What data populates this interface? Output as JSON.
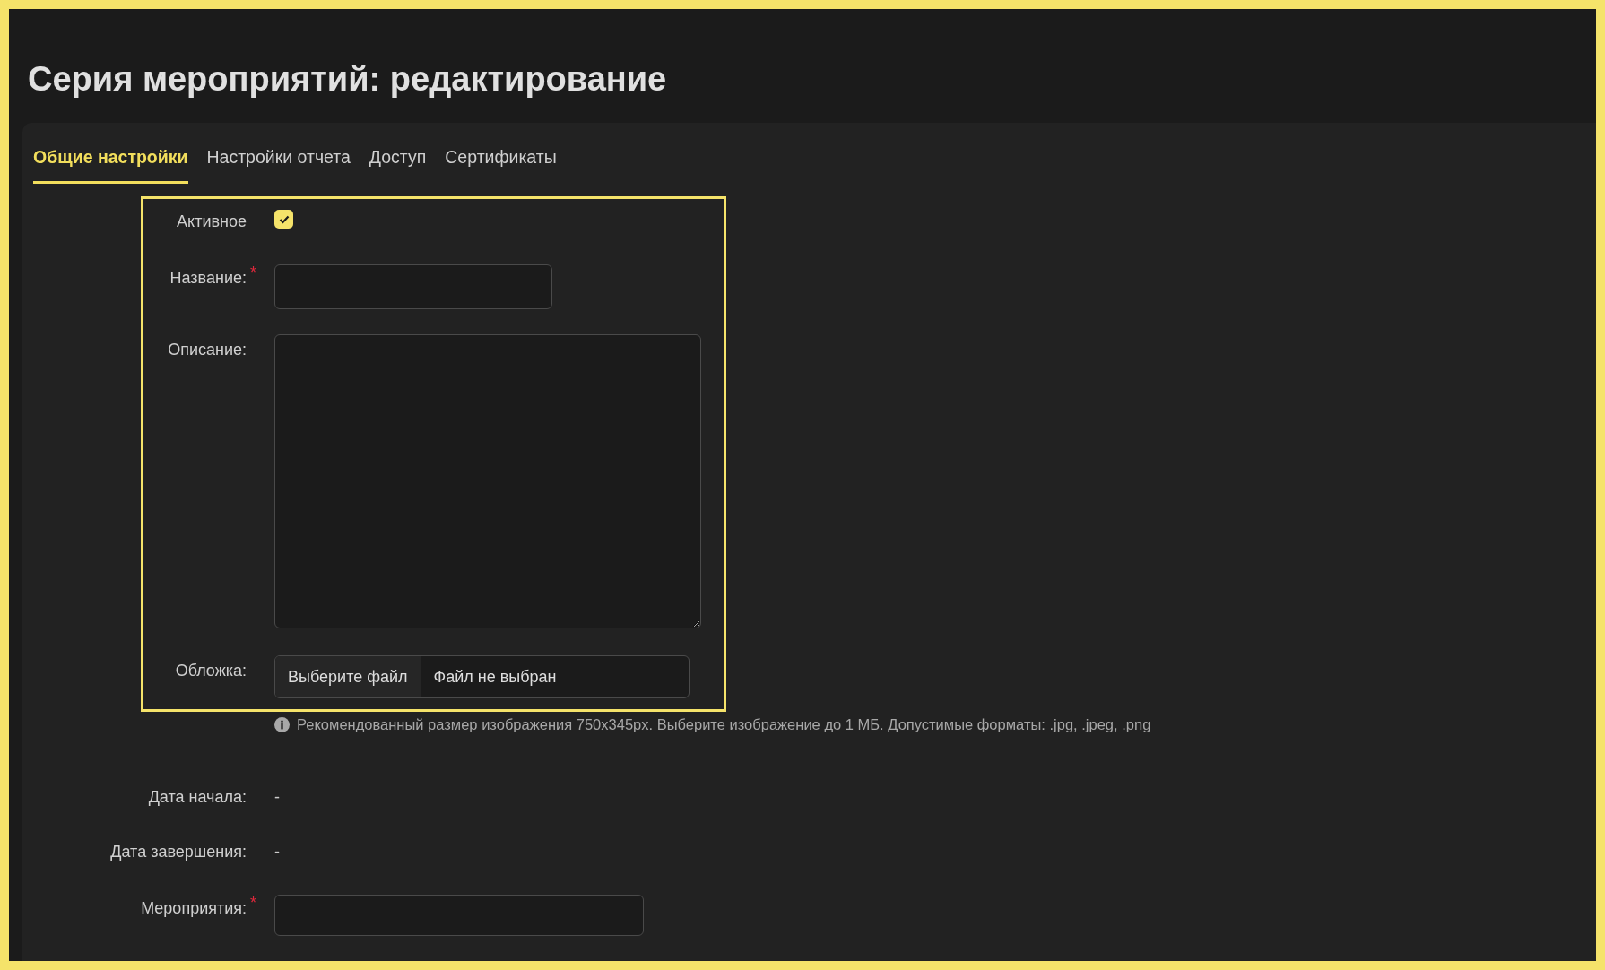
{
  "title": "Серия мероприятий: редактирование",
  "tabs": [
    {
      "label": "Общие настройки",
      "selected": true
    },
    {
      "label": "Настройки отчета",
      "selected": false
    },
    {
      "label": "Доступ",
      "selected": false
    },
    {
      "label": "Сертификаты",
      "selected": false
    }
  ],
  "form": {
    "rows": [
      {
        "kind": "checkbox",
        "label": "Активное",
        "checked": true,
        "highlighted": true
      },
      {
        "kind": "text",
        "label": "Название:",
        "required_mark": "*",
        "highlighted": true
      },
      {
        "kind": "textarea",
        "label": "Описание:",
        "highlighted": true
      },
      {
        "kind": "file",
        "label": "Обложка:",
        "button": "Выберите файл",
        "value": "Файл не выбран",
        "highlighted": true
      },
      {
        "kind": "hint",
        "text": "Рекомендованный размер изображения 750x345px. Выберите изображение до 1 МБ. Допустимые форматы: .jpg, .jpeg, .png",
        "highlighted": false
      },
      {
        "kind": "static",
        "label": "Дата начала:",
        "value": "-",
        "highlighted": false
      },
      {
        "kind": "static",
        "label": "Дата завершения:",
        "value": "-",
        "highlighted": false
      },
      {
        "kind": "text",
        "label": "Мероприятия:",
        "required_mark": "*",
        "highlighted": false
      }
    ]
  }
}
